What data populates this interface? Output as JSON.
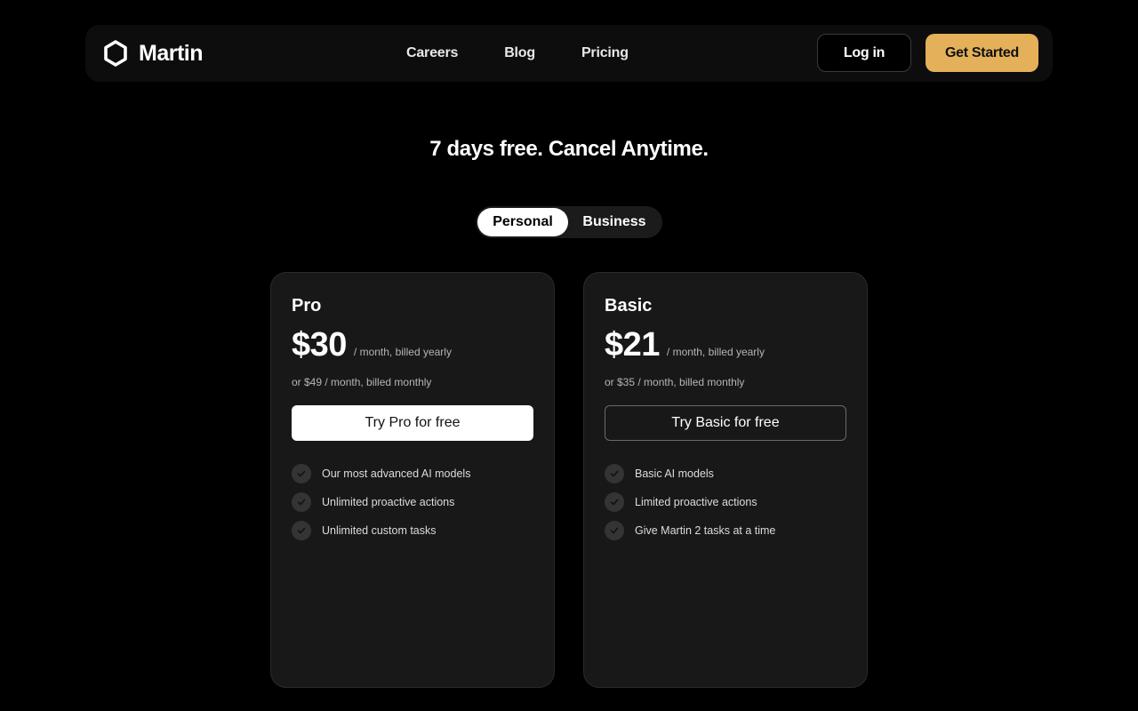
{
  "header": {
    "brand_name": "Martin",
    "brand_icon": "hexagon-logo-icon",
    "nav_links": [
      "Careers",
      "Blog",
      "Pricing"
    ],
    "login_label": "Log in",
    "get_started_label": "Get Started"
  },
  "hero": {
    "headline": "7 days free. Cancel Anytime."
  },
  "billing_toggle": {
    "options": [
      "Personal",
      "Business"
    ],
    "selected": "Personal"
  },
  "plans": [
    {
      "name": "Pro",
      "price": "$30",
      "price_note": "/ month, billed yearly",
      "alt_price": "or $49 / month, billed monthly",
      "cta_label": "Try Pro for free",
      "features": [
        "Our most advanced AI models",
        "Unlimited proactive actions",
        "Unlimited custom tasks"
      ]
    },
    {
      "name": "Basic",
      "price": "$21",
      "price_note": "/ month, billed yearly",
      "alt_price": "or $35 / month, billed monthly",
      "cta_label": "Try Basic for free",
      "features": [
        "Basic AI models",
        "Limited proactive actions",
        "Give Martin 2 tasks at a time"
      ]
    }
  ],
  "colors": {
    "background": "#000000",
    "nav_background": "#0d0d0d",
    "card_background": "#181818",
    "accent": "#e4b05a"
  }
}
